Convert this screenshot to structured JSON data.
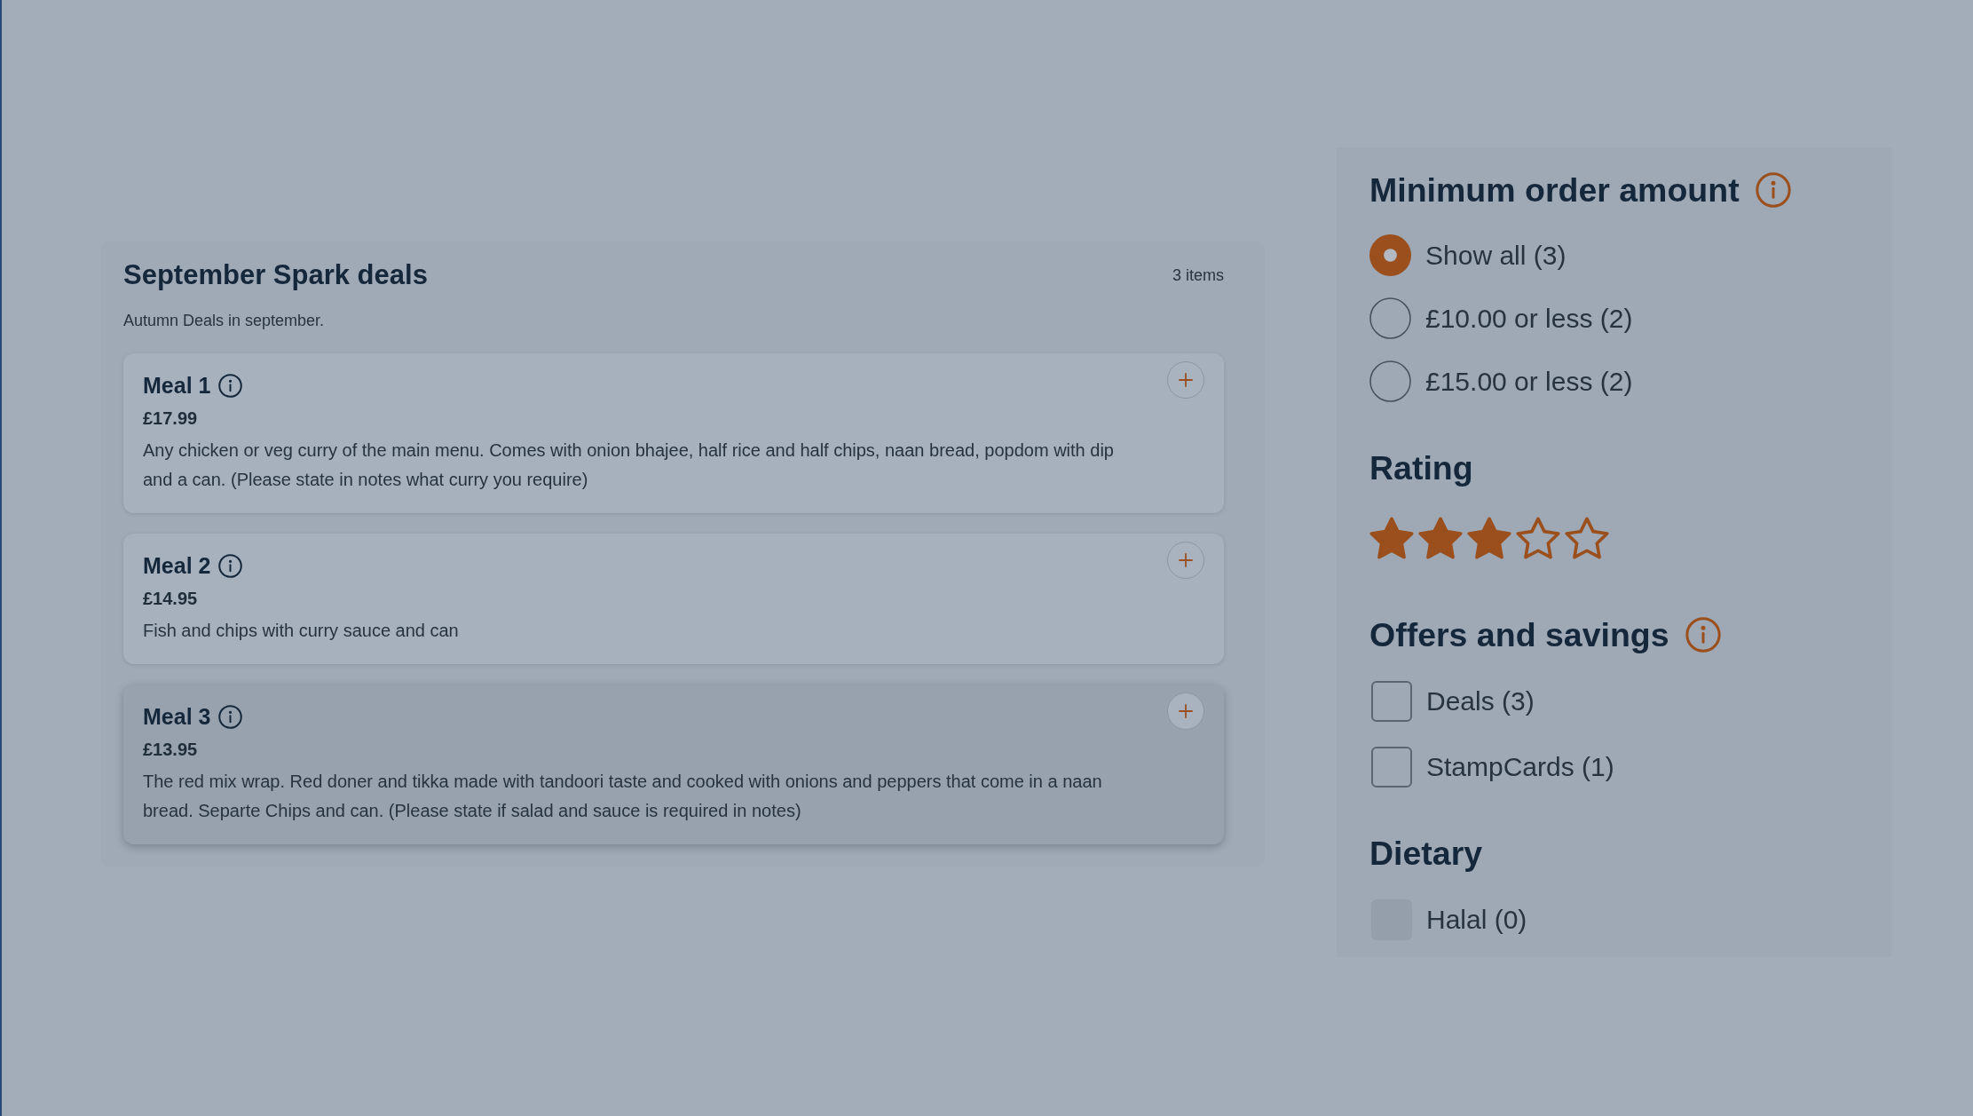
{
  "deals": {
    "title": "September Spark deals",
    "count": "3 items",
    "subtitle": "Autumn Deals in september.",
    "meals": [
      {
        "name": "Meal 1",
        "price": "£17.99",
        "description": "Any chicken or veg curry of the main menu. Comes with onion bhajee, half rice and half chips, naan bread, popdom with dip and a can. (Please state in notes what curry you require)",
        "hovered": false
      },
      {
        "name": "Meal 2",
        "price": "£14.95",
        "description": "Fish and chips with curry sauce and can",
        "hovered": false
      },
      {
        "name": "Meal 3",
        "price": "£13.95",
        "description": "The red mix wrap. Red doner and tikka made with tandoori taste and cooked with onions and peppers that come in a naan bread. Separte Chips and can. (Please state if salad and sauce is required in notes)",
        "hovered": true
      }
    ]
  },
  "filters": {
    "sections": [
      {
        "kind": "radio",
        "title": "Minimum order amount",
        "info": true,
        "options": [
          {
            "label": "Show all (3)",
            "selected": true
          },
          {
            "label": "£10.00 or less (2)",
            "selected": false
          },
          {
            "label": "£15.00 or less (2)",
            "selected": false
          }
        ]
      },
      {
        "kind": "rating",
        "title": "Rating",
        "info": false,
        "stars": 3
      },
      {
        "kind": "checkbox",
        "title": "Offers and savings",
        "info": true,
        "options": [
          {
            "label": "Deals (3)",
            "checked": false,
            "disabled": false
          },
          {
            "label": "StampCards (1)",
            "checked": false,
            "disabled": false
          }
        ]
      },
      {
        "kind": "checkbox",
        "title": "Dietary",
        "info": false,
        "options": [
          {
            "label": "Halal (0)",
            "checked": false,
            "disabled": true
          }
        ]
      }
    ]
  }
}
